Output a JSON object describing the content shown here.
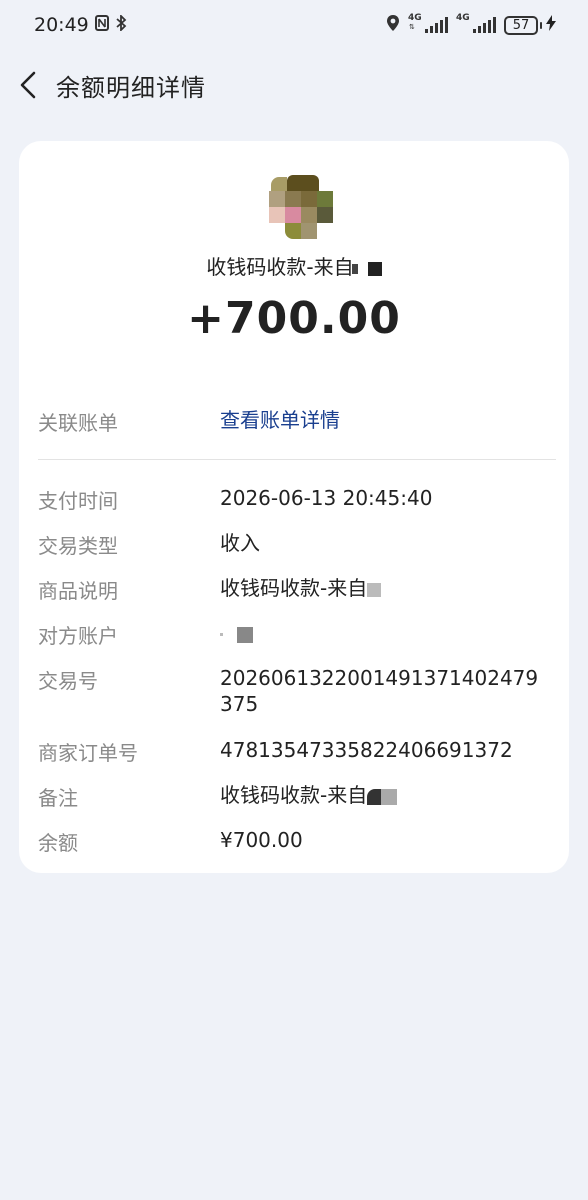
{
  "status_bar": {
    "time": "20:49",
    "nfc_icon": "nfc-icon",
    "bluetooth_icon": "bluetooth-icon",
    "network1": "4G",
    "network2": "4G",
    "battery": "57"
  },
  "header": {
    "title": "余额明细详情",
    "back_icon": "chevron-left-icon"
  },
  "summary": {
    "source": "收钱码收款-来自",
    "amount": "+700.00"
  },
  "related": {
    "label": "关联账单",
    "link": "查看账单详情"
  },
  "details": [
    {
      "label": "支付时间",
      "value": "2026-06-13 20:45:40"
    },
    {
      "label": "交易类型",
      "value": "收入"
    },
    {
      "label": "商品说明",
      "value": "收钱码收款-来自"
    },
    {
      "label": "对方账户",
      "value": ""
    },
    {
      "label": "交易号",
      "value": "2026061322001491371402479375"
    },
    {
      "label": "商家订单号",
      "value": "47813547335822406691372"
    },
    {
      "label": "备注",
      "value": "收钱码收款-来自"
    },
    {
      "label": "余额",
      "value": "¥700.00"
    }
  ]
}
